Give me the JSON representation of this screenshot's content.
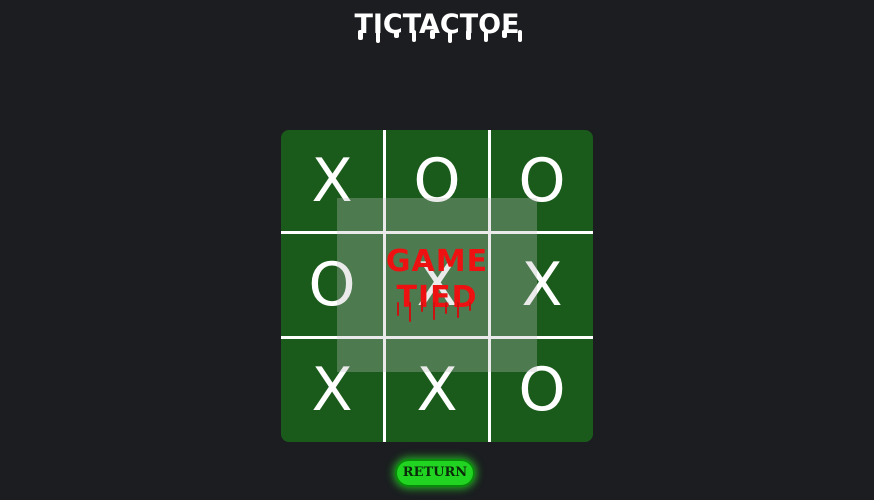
{
  "title": "TICTACTOE",
  "board": [
    [
      "X",
      "O",
      "O"
    ],
    [
      "O",
      "X",
      "X"
    ],
    [
      "X",
      "X",
      "O"
    ]
  ],
  "result": {
    "line1": "GAME",
    "line2": "TIED"
  },
  "return_button": "RETURN",
  "colors": {
    "background": "#1b1d20",
    "board": "#1a5b1b",
    "mark": "#ffffff",
    "result_text": "#ee1111",
    "button": "#21d421"
  }
}
